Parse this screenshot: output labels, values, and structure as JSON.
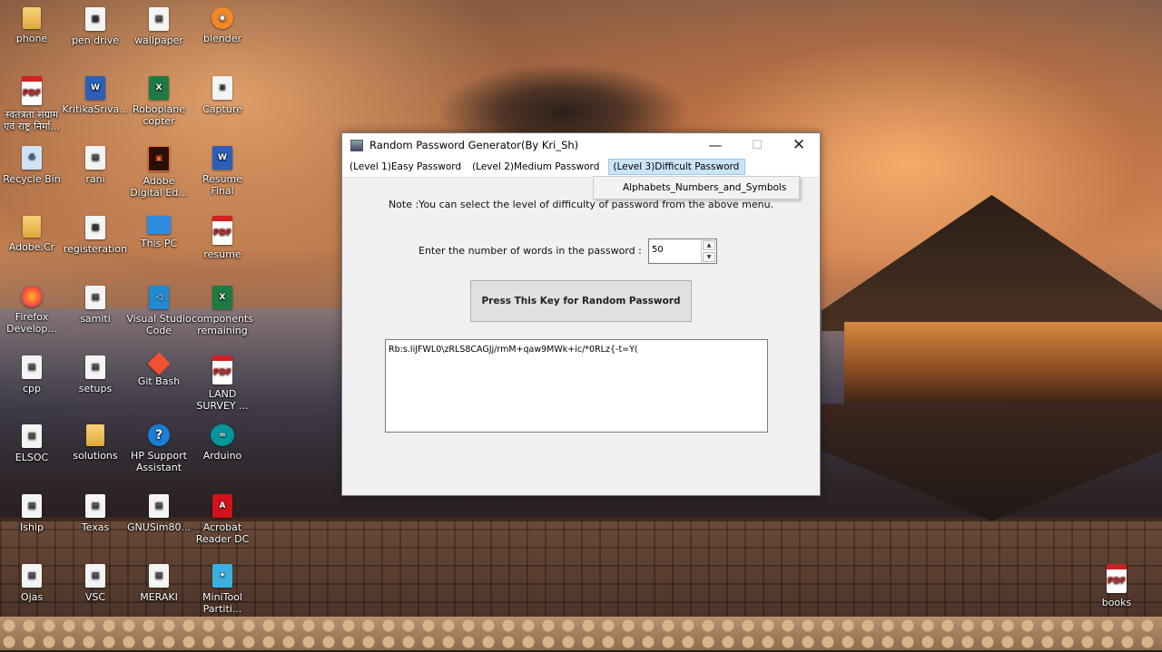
{
  "desktop": {
    "icons": [
      {
        "label": "phone",
        "type": "folder",
        "glyph": ""
      },
      {
        "label": "pen drive",
        "type": "file",
        "glyph": "▦"
      },
      {
        "label": "wallpaper",
        "type": "file",
        "glyph": "▤"
      },
      {
        "label": "blender",
        "type": "blender",
        "glyph": "◉"
      },
      {
        "label": "स्वतंत्रता संग्राम एवं राष्ट्र निर्मा...",
        "type": "pdf",
        "glyph": "PDF"
      },
      {
        "label": "KritikaSriva...",
        "type": "word",
        "glyph": "W"
      },
      {
        "label": "Roboplane copter",
        "type": "excel",
        "glyph": "X"
      },
      {
        "label": "Capture",
        "type": "file",
        "glyph": "≡"
      },
      {
        "label": "Recycle Bin",
        "type": "bin",
        "glyph": "♻"
      },
      {
        "label": "rani",
        "type": "file",
        "glyph": "▤"
      },
      {
        "label": "Adobe Digital Ed...",
        "type": "adobe",
        "glyph": "▣"
      },
      {
        "label": "Resume Final",
        "type": "word",
        "glyph": "W"
      },
      {
        "label": "Adobe.Cr",
        "type": "folder",
        "glyph": ""
      },
      {
        "label": "registeration",
        "type": "file",
        "glyph": "▦"
      },
      {
        "label": "This PC",
        "type": "pc",
        "glyph": ""
      },
      {
        "label": "resume",
        "type": "pdf",
        "glyph": "PDF"
      },
      {
        "label": "Firefox Develop...",
        "type": "firefox",
        "glyph": ""
      },
      {
        "label": "samiti",
        "type": "file",
        "glyph": "▤"
      },
      {
        "label": "Visual Studio Code",
        "type": "vscode",
        "glyph": "◁"
      },
      {
        "label": "components remaining",
        "type": "excel",
        "glyph": "X"
      },
      {
        "label": "cpp",
        "type": "file",
        "glyph": "▤"
      },
      {
        "label": "setups",
        "type": "file",
        "glyph": "▤"
      },
      {
        "label": "Git Bash",
        "type": "git",
        "glyph": ""
      },
      {
        "label": "LAND SURVEY ...",
        "type": "pdf",
        "glyph": "PDF"
      },
      {
        "label": "ELSOC",
        "type": "file",
        "glyph": "▤"
      },
      {
        "label": "solutions",
        "type": "folder",
        "glyph": ""
      },
      {
        "label": "HP Support Assistant",
        "type": "help",
        "glyph": "?"
      },
      {
        "label": "Arduino",
        "type": "arduino",
        "glyph": "∞"
      },
      {
        "label": "Iship",
        "type": "file",
        "glyph": "▤"
      },
      {
        "label": "Texas",
        "type": "file",
        "glyph": "▤"
      },
      {
        "label": "GNUSim80...",
        "type": "file",
        "glyph": "▤"
      },
      {
        "label": "Acrobat Reader DC",
        "type": "acrobat",
        "glyph": "A"
      },
      {
        "label": "Ojas",
        "type": "file",
        "glyph": "▤"
      },
      {
        "label": "VSC",
        "type": "file",
        "glyph": "▤"
      },
      {
        "label": "MERAKI",
        "type": "file",
        "glyph": "▤"
      },
      {
        "label": "MiniTool Partiti...",
        "type": "tool",
        "glyph": "✦"
      },
      {
        "label": "books",
        "type": "books",
        "glyph": "PDF"
      }
    ]
  },
  "window": {
    "title": "Random Password Generator(By Kri_Sh)",
    "controls": {
      "minimize": "—",
      "maximize": "☐",
      "close": "✕"
    },
    "menu": [
      {
        "label": "(Level 1)Easy Password"
      },
      {
        "label": "(Level 2)Medium Password"
      },
      {
        "label": "(Level 3)Difficult Password"
      }
    ],
    "dropdown_item": "Alphabets_Numbers_and_Symbols",
    "note": "Note :You can select the level of difficulty of password from the above menu.",
    "prompt_label": "Enter the number of words in the password :",
    "spin_value": "50",
    "spin_up": "▲",
    "spin_down": "▼",
    "generate_button": "Press This Key for Random Password",
    "output_text": "Rb:s.IiJFWL0\\zRLS8CAGJj/rmM+qaw9MWk+ic/*0RLz{-t=Y("
  }
}
